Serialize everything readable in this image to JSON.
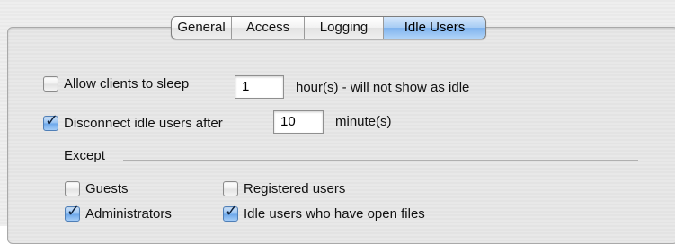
{
  "tabs": [
    {
      "label": "General"
    },
    {
      "label": "Access"
    },
    {
      "label": "Logging"
    },
    {
      "label": "Idle Users"
    }
  ],
  "selected_tab": "Idle Users",
  "sleep": {
    "label": "Allow clients to sleep",
    "checked": false,
    "value": "1",
    "suffix": "hour(s) - will not show as idle"
  },
  "disconnect": {
    "label": "Disconnect idle users after",
    "checked": true,
    "value": "10",
    "suffix": "minute(s)"
  },
  "except": {
    "label": "Except",
    "guests": {
      "label": "Guests",
      "checked": false
    },
    "registered": {
      "label": "Registered users",
      "checked": false
    },
    "administrators": {
      "label": "Administrators",
      "checked": true
    },
    "open_files": {
      "label": "Idle users who have open files",
      "checked": true
    }
  },
  "colors": {
    "accent": "#7fb3ee",
    "panel_border": "#a9a9a9"
  }
}
